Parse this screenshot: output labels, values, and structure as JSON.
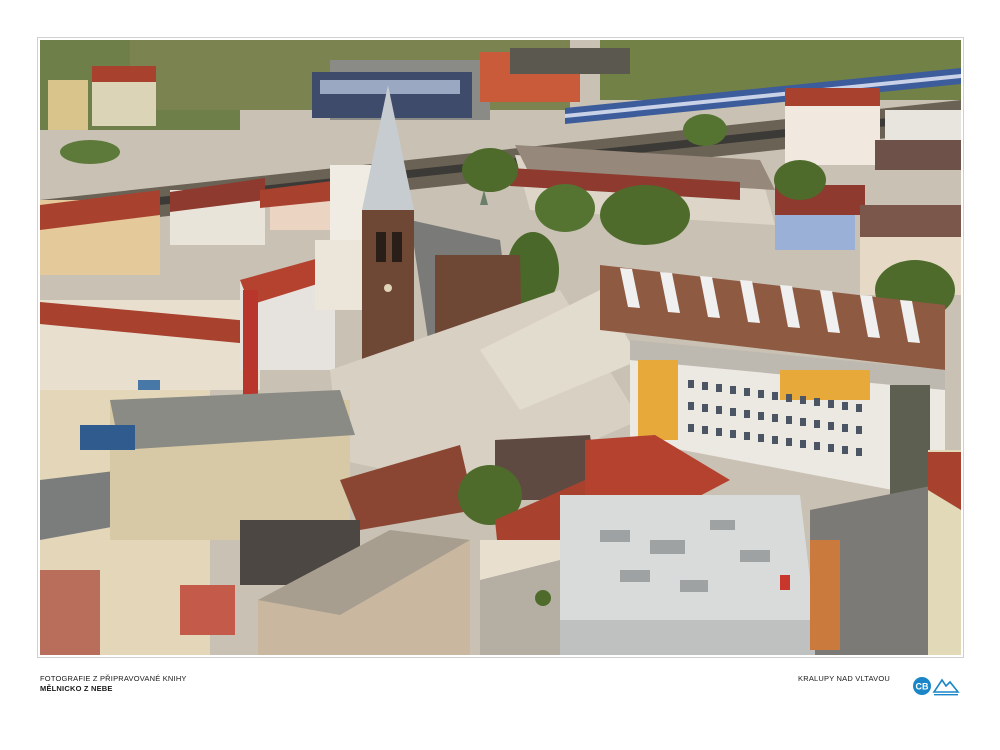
{
  "caption": {
    "line1": "FOTOGRAFIE Z PŘIPRAVOVANÉ KNIHY",
    "line2": "MĚLNICKO Z NEBE",
    "place": "KRALUPY NAD VLTAVOU"
  },
  "logo": {
    "emblem_text": "CB",
    "colors": {
      "emblem": "#1a86c8",
      "mark": "#1a86c8"
    }
  },
  "photo": {
    "subject": "aerial town view",
    "colors": {
      "roof_red": "#a8412e",
      "church_brick": "#6f4735",
      "plaster": "#e8dfcf",
      "yellow_facade": "#e7a93a",
      "train_blue": "#3d5c9c",
      "greenery": "#4e6b2c"
    }
  }
}
